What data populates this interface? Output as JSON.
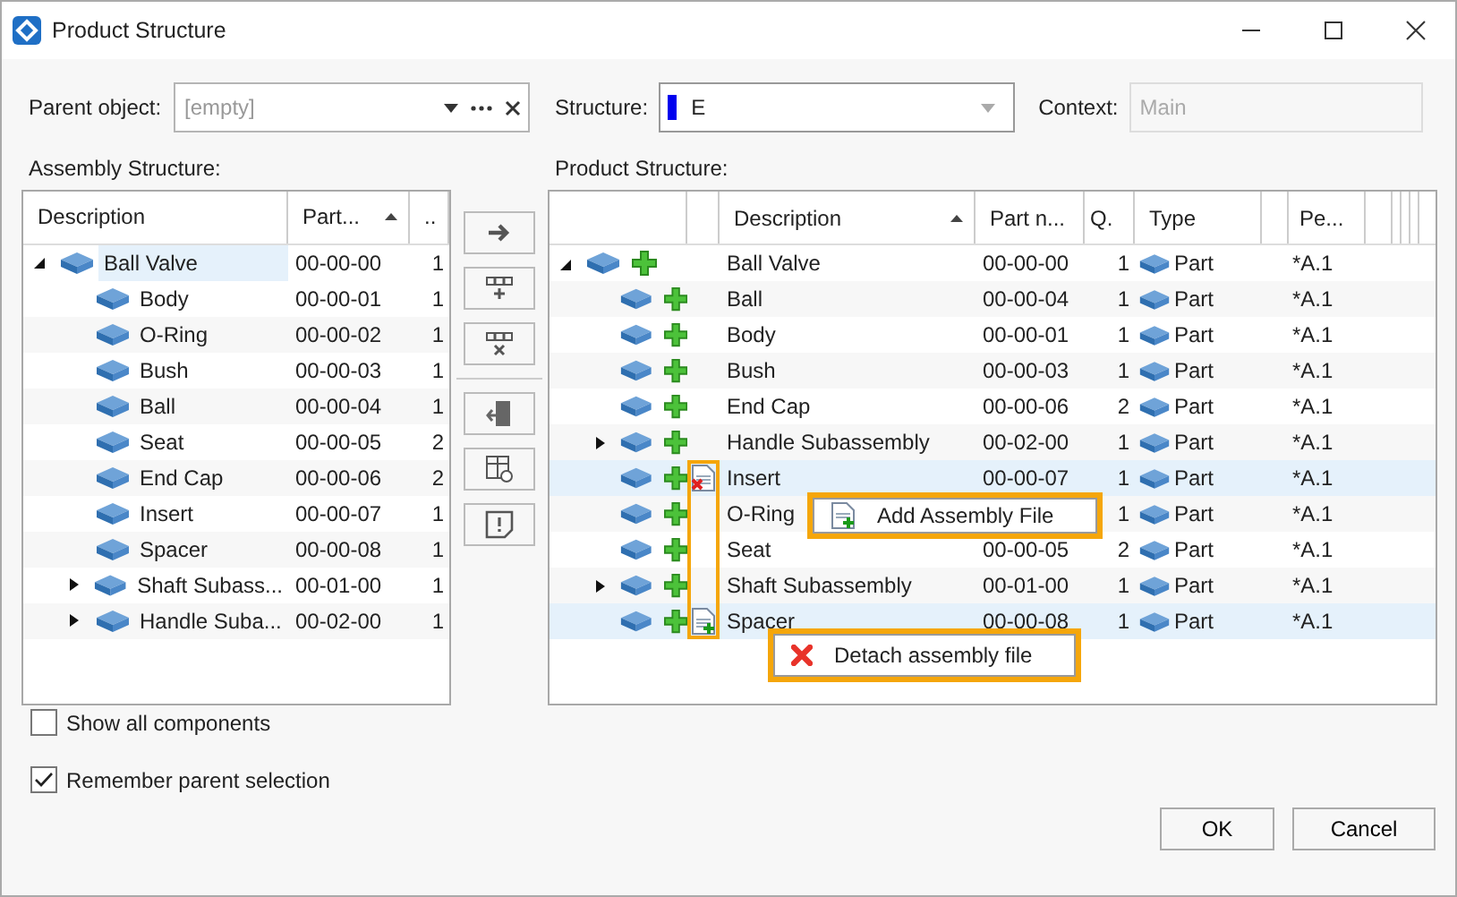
{
  "window": {
    "title": "Product Structure"
  },
  "parent_object": {
    "label": "Parent object:",
    "placeholder": "[empty]"
  },
  "structure": {
    "label": "Structure:",
    "value": "E"
  },
  "context": {
    "label": "Context:",
    "value": "Main",
    "disabled": true
  },
  "assembly_structure": {
    "label": "Assembly Structure:",
    "columns": [
      {
        "label": "Description",
        "sorted": false
      },
      {
        "label": "Part...",
        "sorted": true
      },
      {
        "label": ".."
      }
    ],
    "tree": [
      {
        "description": "Ball Valve",
        "part": "00-00-00",
        "qty": "1",
        "expanded": true,
        "selected": true,
        "children": [
          {
            "description": "Body",
            "part": "00-00-01",
            "qty": "1",
            "selected": false
          },
          {
            "description": "O-Ring",
            "part": "00-00-02",
            "qty": "1",
            "selected": false
          },
          {
            "description": "Bush",
            "part": "00-00-03",
            "qty": "1",
            "selected": false
          },
          {
            "description": "Ball",
            "part": "00-00-04",
            "qty": "1",
            "selected": false
          },
          {
            "description": "Seat",
            "part": "00-00-05",
            "qty": "2",
            "selected": false
          },
          {
            "description": "End Cap",
            "part": "00-00-06",
            "qty": "2",
            "selected": false
          },
          {
            "description": "Insert",
            "part": "00-00-07",
            "qty": "1",
            "selected": false
          },
          {
            "description": "Spacer",
            "part": "00-00-08",
            "qty": "1",
            "selected": false
          },
          {
            "description": "Shaft Subass...",
            "part": "00-01-00",
            "qty": "1",
            "expanded": false,
            "selected": false
          },
          {
            "description": "Handle Suba...",
            "part": "00-02-00",
            "qty": "1",
            "expanded": false,
            "selected": false
          }
        ]
      }
    ]
  },
  "product_structure": {
    "label": "Product Structure:",
    "columns": [
      {
        "label": "Description",
        "sorted": true
      },
      {
        "label": "Part n...",
        "sorted": false
      },
      {
        "label": "Q.",
        "sorted": false
      },
      {
        "label": "Type",
        "sorted": false
      },
      {
        "label": "Pe...",
        "sorted": false
      }
    ],
    "tree": [
      {
        "description": "Ball Valve",
        "part_no": "00-00-00",
        "qty": "1",
        "type": "Part",
        "pe": "*A.1",
        "expanded": true,
        "selected": false,
        "children": [
          {
            "kind": "plain",
            "description": "Ball",
            "part_no": "00-00-04",
            "qty": "1",
            "type": "Part",
            "pe": "*A.1",
            "selected": false
          },
          {
            "kind": "plain",
            "description": "Body",
            "part_no": "00-00-01",
            "qty": "1",
            "type": "Part",
            "pe": "*A.1",
            "selected": false
          },
          {
            "kind": "plain",
            "description": "Bush",
            "part_no": "00-00-03",
            "qty": "1",
            "type": "Part",
            "pe": "*A.1",
            "selected": false
          },
          {
            "kind": "plain",
            "description": "End Cap",
            "part_no": "00-00-06",
            "qty": "2",
            "type": "Part",
            "pe": "*A.1",
            "selected": false
          },
          {
            "kind": "plain",
            "description": "Handle Subassembly",
            "part_no": "00-02-00",
            "qty": "1",
            "type": "Part",
            "pe": "*A.1",
            "expanded": false,
            "selected": false
          },
          {
            "kind": "detached",
            "description": "Insert",
            "part_no": "00-00-07",
            "qty": "1",
            "type": "Part",
            "pe": "*A.1",
            "selected": true
          },
          {
            "kind": "plain",
            "description": "O-Ring",
            "qty": "1",
            "type": "Part",
            "pe": "*A.1",
            "selected": false
          },
          {
            "kind": "plain",
            "description": "Seat",
            "part_no": "00-00-05",
            "qty": "2",
            "type": "Part",
            "pe": "*A.1",
            "selected": false
          },
          {
            "kind": "plain",
            "description": "Shaft Subassembly",
            "part_no": "00-01-00",
            "qty": "1",
            "type": "Part",
            "pe": "*A.1",
            "expanded": false,
            "selected": false
          },
          {
            "kind": "attached",
            "description": "Spacer",
            "part_no": "00-00-08",
            "qty": "1",
            "type": "Part",
            "pe": "*A.1",
            "selected": true
          }
        ]
      }
    ]
  },
  "callouts": [
    {
      "kind": "add",
      "label": "Add Assembly File"
    },
    {
      "kind": "detach",
      "label": "Detach assembly file"
    }
  ],
  "checkboxes": [
    {
      "label": "Show all components",
      "checked": false
    },
    {
      "label": "Remember parent selection",
      "checked": true
    }
  ],
  "buttons": [
    "OK",
    "Cancel"
  ]
}
